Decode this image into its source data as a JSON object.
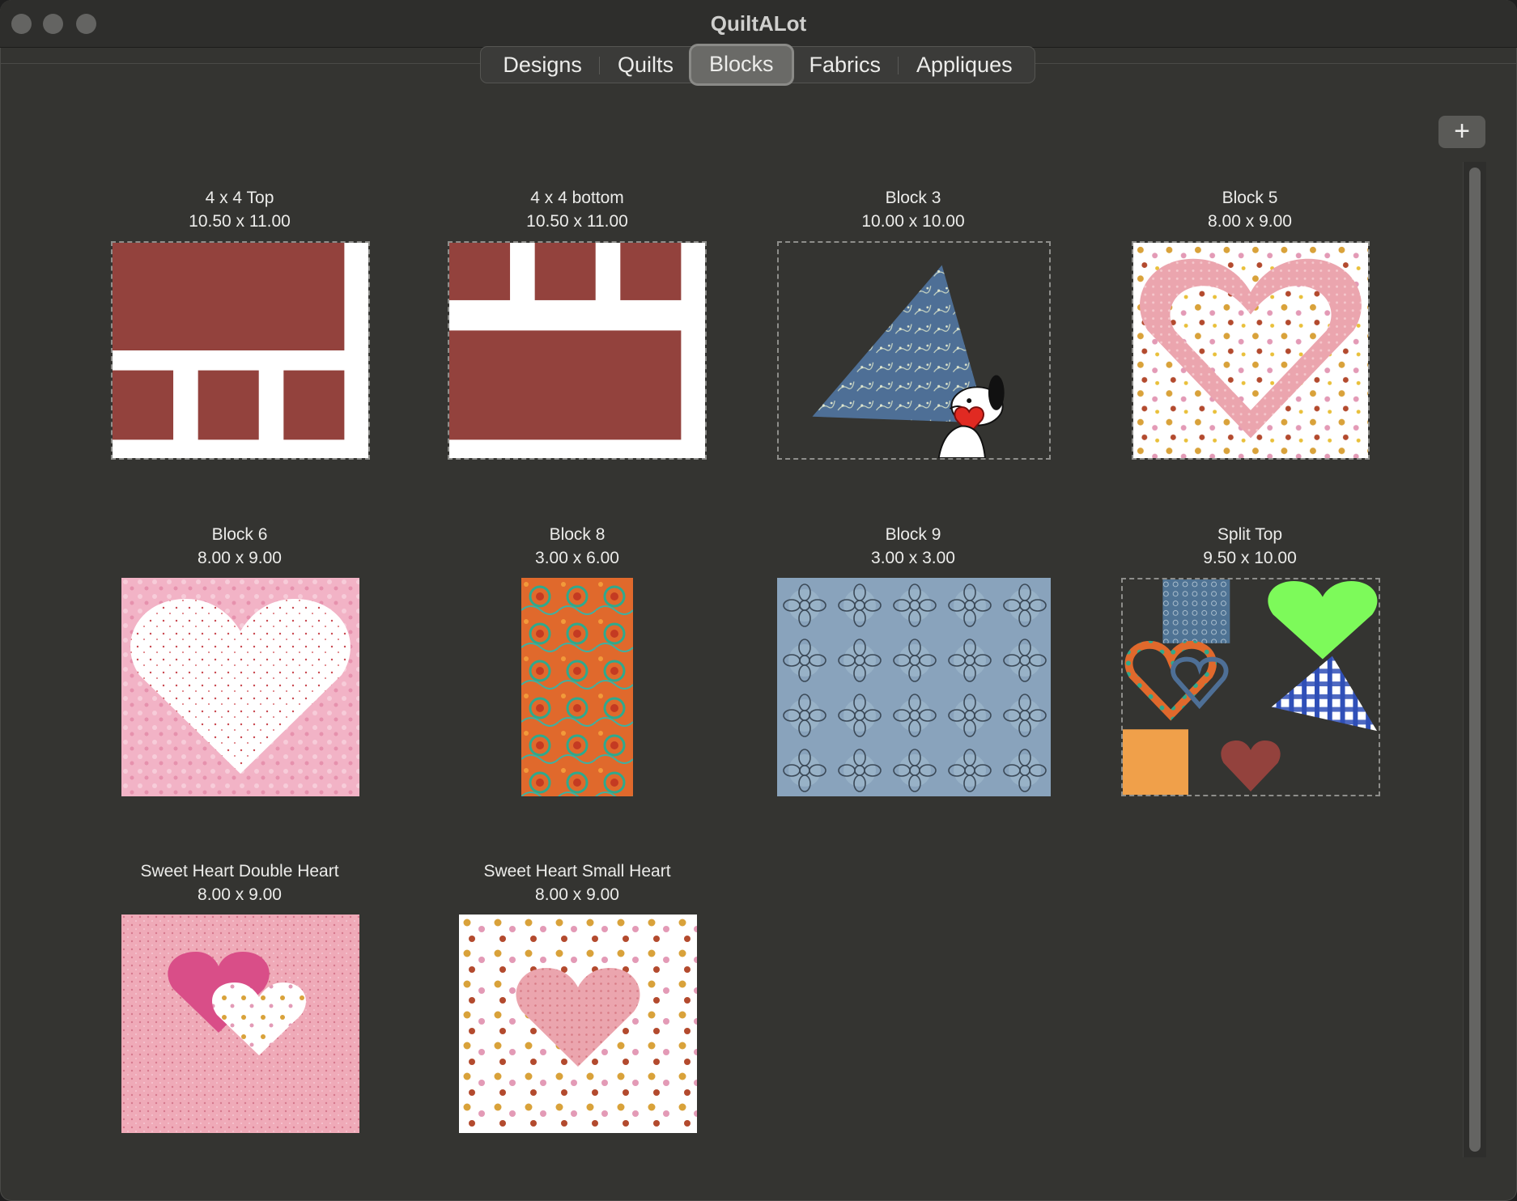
{
  "window": {
    "title": "QuiltALot"
  },
  "tabs": [
    {
      "label": "Designs"
    },
    {
      "label": "Quilts"
    },
    {
      "label": "Blocks"
    },
    {
      "label": "Fabrics"
    },
    {
      "label": "Appliques"
    }
  ],
  "active_tab": "Blocks",
  "toolbar": {
    "add_label": "+"
  },
  "blocks": [
    {
      "name": "4 x 4 Top",
      "size": "10.50 x 11.00"
    },
    {
      "name": "4 x 4 bottom",
      "size": "10.50 x 11.00"
    },
    {
      "name": "Block 3",
      "size": "10.00 x 10.00"
    },
    {
      "name": "Block 5",
      "size": "8.00 x 9.00"
    },
    {
      "name": "Block 6",
      "size": "8.00 x 9.00"
    },
    {
      "name": "Block 8",
      "size": "3.00 x 6.00"
    },
    {
      "name": "Block 9",
      "size": "3.00 x 3.00"
    },
    {
      "name": "Split Top",
      "size": "9.50 x 10.00"
    },
    {
      "name": "Sweet Heart Double Heart",
      "size": "8.00 x 9.00"
    },
    {
      "name": "Sweet Heart Small Heart",
      "size": "8.00 x 9.00"
    }
  ],
  "colors": {
    "brick": "#93423d",
    "window_bg": "#343431",
    "pink": "#f1b5c3",
    "denim": "#4e6f96",
    "orange": "#e0692c",
    "green": "#7dfa5a"
  }
}
